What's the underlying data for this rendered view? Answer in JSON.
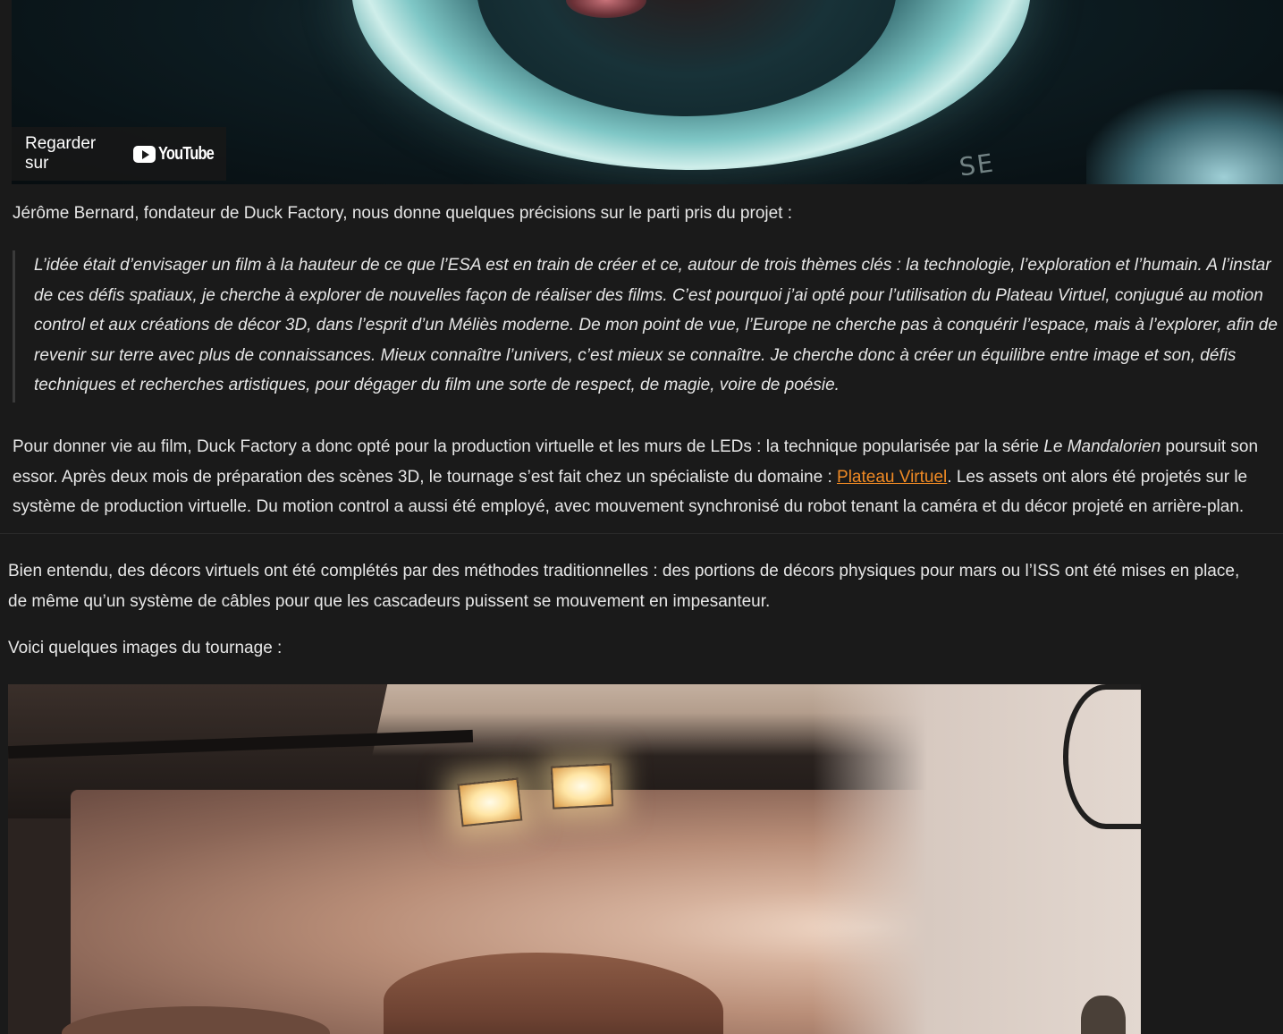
{
  "video": {
    "watch_label": "Regarder sur",
    "platform_name": "YouTube",
    "suit_mark": "SE",
    "icon": "youtube-logo-icon"
  },
  "article": {
    "intro": "Jérôme Bernard, fondateur de Duck Factory, nous donne quelques précisions sur le parti pris du projet :",
    "quote_lines": [
      "L’idée était d’envisager un film à la hauteur de ce que l’ESA est en train de créer et ce, autour de trois thèmes clés : la technologie, l’exploration et l’humain. A l’instar",
      "de ces défis spatiaux, je cherche à explorer de nouvelles façon de réaliser des films. C’est pourquoi j’ai opté pour l’utilisation du Plateau Virtuel, conjugué au motion",
      "control et aux créations de décor 3D, dans l’esprit d’un Méliès moderne. De mon point de vue, l’Europe ne cherche pas à conquérir l’espace, mais à l’explorer, afin de",
      "revenir sur terre avec plus de connaissances. Mieux connaître l’univers, c’est mieux se connaître. Je cherche donc à créer un équilibre entre image et son, défis",
      "techniques et recherches artistiques, pour dégager du film une sorte de respect, de magie, voire de poésie."
    ],
    "para1": {
      "line1_before": "Pour donner vie au film, Duck Factory a donc opté pour la production virtuelle et les murs de LEDs : la technique popularisée par la série ",
      "line1_em": "Le Mandalorien",
      "line1_after": " poursuit son",
      "line2_before": "essor. Après deux mois de préparation des scènes 3D, le tournage s’est fait chez un spécialiste du domaine : ",
      "link_text": "Plateau Virtuel",
      "line2_after": ". Les assets ont alors été projetés sur le",
      "line3": "système de production virtuelle. Du motion control a aussi été employé, avec mouvement synchronisé du robot tenant la caméra et du décor projeté en arrière-plan."
    },
    "para2_lines": [
      "Bien entendu, des décors virtuels ont été complétés par des méthodes traditionnelles : des portions de décors physiques pour mars ou l’ISS ont été mises en place,",
      "de même qu’un système de câbles pour que les cascadeurs puissent se mouvement en impesanteur."
    ],
    "para3": "Voici quelques images du tournage :"
  },
  "colors": {
    "background": "#1a1a1a",
    "text": "#e6e6e6",
    "link": "#f08a24",
    "quote_border": "#3a3a3a"
  }
}
